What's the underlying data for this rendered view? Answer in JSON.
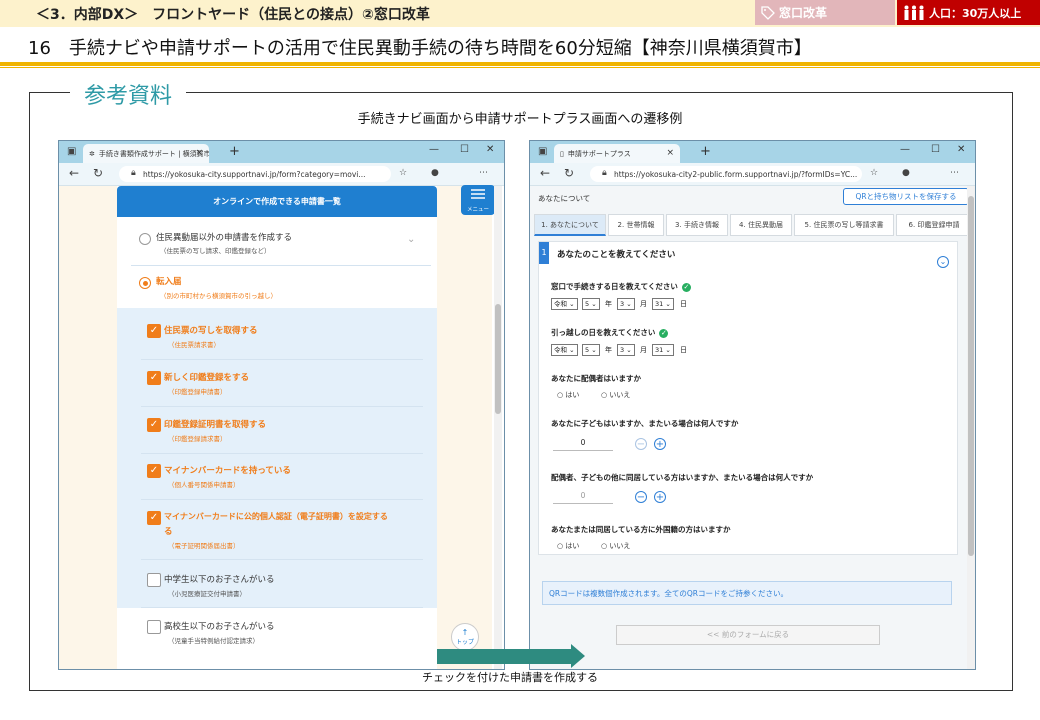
{
  "header": {
    "section": "＜3．内部DX＞　フロントヤード（住民との接点）②窓口改革",
    "tag_category": "窓口改革",
    "tag_population": "人口：30万人以上",
    "title": "16　手続ナビや申請サポートの活用で住民異動手続の待ち時間を60分短縮【神奈川県横須賀市】",
    "colors": {
      "band": "#fdf2cc",
      "accent_gold": "#f0b400",
      "tag_pink": "#e2b6ba",
      "tag_red": "#c00000",
      "teal": "#2e9aa6"
    }
  },
  "panel": {
    "label": "参考資料",
    "subtitle": "手続きナビ画面から申請サポートプラス画面への遷移例",
    "caption": "チェックを付けた申請書を作成する"
  },
  "left_browser": {
    "tab_title": "手続き書類作成サポート | 横須賀市",
    "url": "https://yokosuka-city.supportnavi.jp/form?category=movi...",
    "list_header": "オンラインで作成できる申請書一覧",
    "menu_label": "メニュー",
    "options": [
      {
        "label": "住民異動届以外の申請書を作成する",
        "note": "（住民票の写し請求、印鑑登録など）",
        "selected": false
      },
      {
        "label": "転入届",
        "note": "（別の市町村から横須賀市の引っ越し）",
        "selected": true
      }
    ],
    "items": [
      {
        "label": "住民票の写しを取得する",
        "note": "（住民票請求書）",
        "checked": true
      },
      {
        "label": "新しく印鑑登録をする",
        "note": "（印鑑登録申請書）",
        "checked": true
      },
      {
        "label": "印鑑登録証明書を取得する",
        "note": "（印鑑登録請求書）",
        "checked": true
      },
      {
        "label": "マイナンバーカードを持っている",
        "note": "（個人番号関係申請書）",
        "checked": true
      },
      {
        "label": "マイナンバーカードに公的個人認証（電子証明書）を設定する",
        "label2": "る",
        "note": "（電子証明関係届出書）",
        "checked": true
      },
      {
        "label": "中学生以下のお子さんがいる",
        "note": "（小児医療証交付申請書）",
        "checked": false
      },
      {
        "label": "高校生以下のお子さんがいる",
        "note": "（児童手当特例給付認定請求）",
        "checked": false
      }
    ],
    "top_button": "トップ"
  },
  "right_browser": {
    "tab_title": "申請サポートプラス",
    "url": "https://yokosuka-city2-public.form.supportnavi.jp/?formIDs=YC...",
    "page_label": "あなたについて",
    "save_button": "QRと持ち物リストを保存する",
    "tabs": [
      "1. あなたについて",
      "2. 世帯情報",
      "3. 手続き情報",
      "4. 住民異動届",
      "5. 住民票の写し等請求書",
      "6. 印鑑登録申請"
    ],
    "section_number": "1",
    "section_title": "あなたのことを教えてください",
    "q1": "窓口で手続きする日を教えてください",
    "q2": "引っ越しの日を教えてください",
    "date": {
      "era": "令和",
      "year": "5",
      "month": "3",
      "day": "31",
      "year_unit": "年",
      "month_unit": "月",
      "day_unit": "日"
    },
    "q3": "あなたに配偶者はいますか",
    "yes": "はい",
    "no": "いいえ",
    "q4": "あなたに子どもはいますか、またいる場合は何人ですか",
    "q4_value": "0",
    "q5": "配偶者、子どもの他に同居している方はいますか、またいる場合は何人ですか",
    "q5_value": "0",
    "q6": "あなたまたは同居している方に外国籍の方はいますか",
    "qr_note": "QRコードは複数個作成されます。全てのQRコードをご持参ください。",
    "prev_button": "<< 前のフォームに戻る"
  }
}
